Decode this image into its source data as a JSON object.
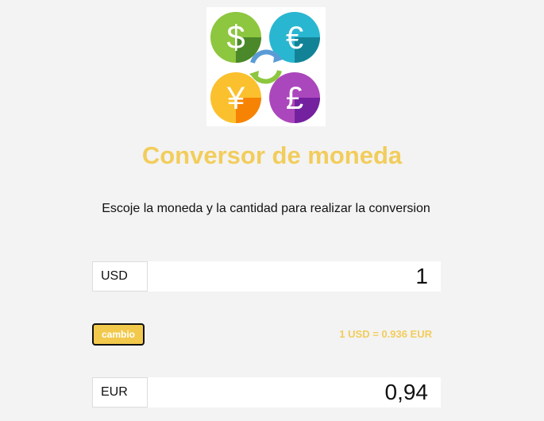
{
  "app": {
    "title": "Conversor de moneda",
    "instructions": "Escoje la moneda y la cantidad para realizar la conversion"
  },
  "logo": {
    "icons": [
      "dollar-coin-icon",
      "euro-coin-icon",
      "yen-coin-icon",
      "pound-coin-icon",
      "exchange-arrows-icon"
    ],
    "symbols": {
      "dollar": "$",
      "euro": "€",
      "yen": "¥",
      "pound": "£"
    },
    "colors": {
      "dollar": "#8dc63f",
      "euro": "#29b6d1",
      "yen": "#fbc02d",
      "pound": "#ab47bc"
    }
  },
  "from": {
    "currency": "USD",
    "amount": "1"
  },
  "swap": {
    "label": "cambio"
  },
  "rate": {
    "text": "1 USD = 0.936 EUR"
  },
  "to": {
    "currency": "EUR",
    "amount": "0,94"
  },
  "colors": {
    "accent": "#f2cd5c",
    "background": "#f3f3f3"
  }
}
